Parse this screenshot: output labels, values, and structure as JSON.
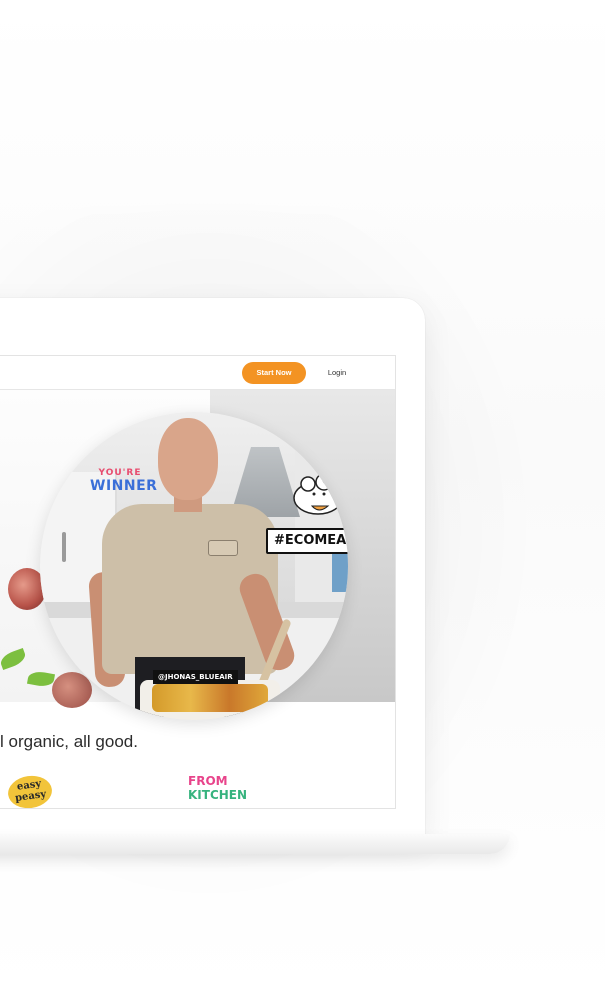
{
  "nav": {
    "start_label": "Start Now",
    "login_label": "Login",
    "accent_color": "#f39323"
  },
  "hero": {
    "sticker_youre": "YOU'RE",
    "sticker_winner": "WINNER",
    "hashtag": "#ECOMEAL",
    "handle": "@JHONAS_BLUEAIR"
  },
  "tagline": "l organic, all good.",
  "brands": {
    "easy_line1": "easy",
    "easy_line2": "peasy",
    "kitchen_line1": "FROM",
    "kitchen_line2": "KITCHEN"
  }
}
